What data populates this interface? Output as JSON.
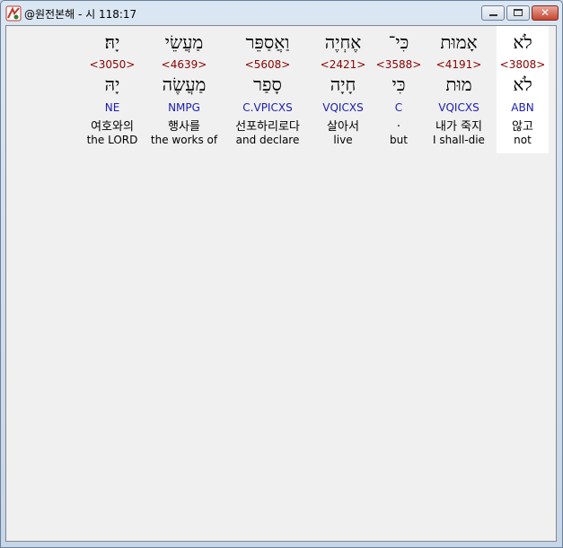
{
  "window": {
    "title": "@원전본해 - 시 118:17",
    "controls": {
      "minimize": "minimize",
      "maximize": "maximize",
      "close": "✕"
    }
  },
  "words": [
    {
      "hebrew": "לֹא",
      "strong": "<3808>",
      "lemma": "לֹא",
      "morph": "ABN",
      "korean": "않고",
      "english": "not",
      "selected": true
    },
    {
      "hebrew": "אָמוּת",
      "strong": "<4191>",
      "lemma": "מוּת",
      "morph": "VQICXS",
      "korean": "내가 죽지",
      "english": "I shall-die",
      "selected": false
    },
    {
      "hebrew": "כִּי־",
      "strong": "<3588>",
      "lemma": "כִּי",
      "morph": "C",
      "korean": ".",
      "english": "but",
      "selected": false
    },
    {
      "hebrew": "אֶחְיֶה",
      "strong": "<2421>",
      "lemma": "חָיָה",
      "morph": "VQICXS",
      "korean": "살아서",
      "english": "live",
      "selected": false
    },
    {
      "hebrew": "וַאֲסַפֵּר",
      "strong": "<5608>",
      "lemma": "סָפַר",
      "morph": "C.VPICXS",
      "korean": "선포하리로다",
      "english": "and declare",
      "selected": false
    },
    {
      "hebrew": "מַעֲשֵׂי",
      "strong": "<4639>",
      "lemma": "מַעֲשֶׂה",
      "morph": "NMPG",
      "korean": "행사를",
      "english": "the works of",
      "selected": false
    },
    {
      "hebrew": "יָהּ׃",
      "strong": "<3050>",
      "lemma": "יָהּ",
      "morph": "NE",
      "korean": "여호와의",
      "english": "the LORD",
      "selected": false
    }
  ]
}
